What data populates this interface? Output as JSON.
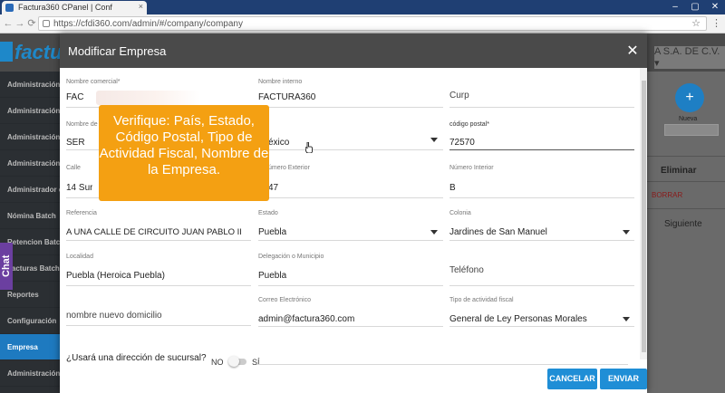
{
  "browser": {
    "tab_title": "Factura360 CPanel | Conf",
    "tab_close": "×",
    "url": "https://cfdi360.com/admin/#/company/company",
    "window_controls": [
      "–",
      "▢",
      "✕"
    ],
    "nav": [
      "←",
      "→",
      "⟳"
    ],
    "star": "☆",
    "menu": "⋮"
  },
  "app": {
    "logo_text": "factura",
    "company_name": "A S.A. DE C.V.",
    "company_caret": "▾"
  },
  "sidebar": {
    "items": [
      {
        "label": "Administración F"
      },
      {
        "label": "Administración N"
      },
      {
        "label": "Administración R"
      },
      {
        "label": "Administración de"
      },
      {
        "label": "Administrador de"
      },
      {
        "label": "Nómina Batch"
      },
      {
        "label": "Retencion Batch"
      },
      {
        "label": "Facturas Batch"
      },
      {
        "label": "Reportes"
      },
      {
        "label": "Configuración"
      },
      {
        "label": "Empresa"
      },
      {
        "label": "Administración de"
      }
    ],
    "chat_label": "Chat"
  },
  "right_panel": {
    "fab_label": "Nueva",
    "fab_icon": "+",
    "eliminar": "Eliminar",
    "borrar": "BORRAR",
    "siguiente": "Siguiente"
  },
  "modal": {
    "title": "Modificar Empresa",
    "close": "✕",
    "fields": {
      "nombre_comercial": {
        "label": "Nombre comercial*",
        "value": "FAC"
      },
      "nombre_interno": {
        "label": "Nombre interno",
        "value": "FACTURA360"
      },
      "curp": {
        "label": "",
        "value": "Curp"
      },
      "nombre_fiscal": {
        "label": "Nombre de",
        "value": "SER"
      },
      "pais": {
        "label": "",
        "value": "éxico"
      },
      "codigo_postal": {
        "label": "código postal*",
        "value": "72570"
      },
      "calle": {
        "label": "Calle",
        "value": "14 Sur"
      },
      "numero_exterior": {
        "label": "úmero Exterior",
        "value": "47"
      },
      "numero_interior": {
        "label": "Número Interior",
        "value": "B"
      },
      "referencia": {
        "label": "Referencia",
        "value": "A UNA CALLE DE CIRCUITO JUAN PABLO II"
      },
      "estado": {
        "label": "Estado",
        "value": "Puebla"
      },
      "colonia": {
        "label": "Colonia",
        "value": "Jardines de San Manuel"
      },
      "localidad": {
        "label": "Localidad",
        "value": "Puebla (Heroica Puebla)"
      },
      "municipio": {
        "label": "Delegación o Municipio",
        "value": "Puebla"
      },
      "telefono": {
        "label": "",
        "value": "Teléfono"
      },
      "nombre_domicilio": {
        "label": "",
        "value": "nombre nuevo domicilio"
      },
      "correo": {
        "label": "Correo Electrónico",
        "value": "admin@factura360.com"
      },
      "actividad": {
        "label": "Tipo de actividad fiscal",
        "value": "General de Ley Personas Morales"
      }
    },
    "sucursal_question": "¿Usará una dirección de sucursal?",
    "toggle_no": "NO",
    "toggle_si": "SÍ",
    "cancel": "CANCELAR",
    "submit": "ENVIAR"
  },
  "callout": {
    "text": "Verifique: País, Estado, Código Postal, Tipo de Actividad Fiscal, Nombre de la Empresa."
  },
  "colors": {
    "accent": "#1f8ed6",
    "callout": "#f4a012",
    "sidebar_active": "#1e7ac0"
  }
}
